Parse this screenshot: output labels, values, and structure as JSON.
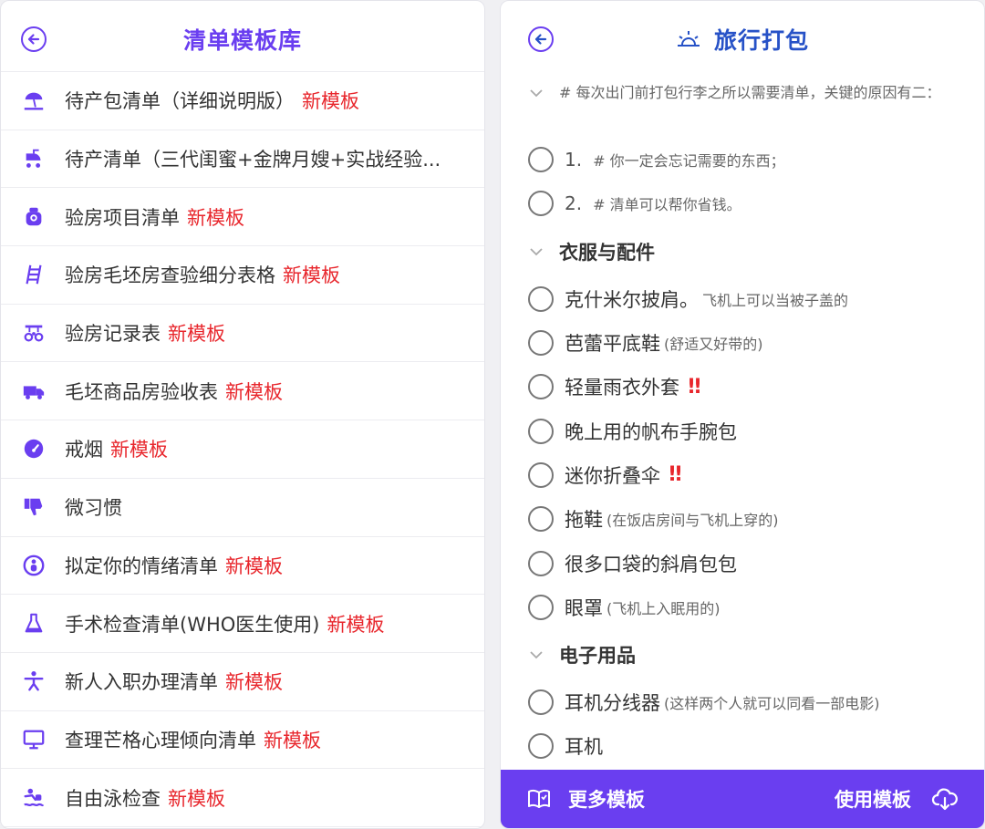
{
  "library": {
    "title": "清单模板库",
    "badge": "新模板",
    "templates": [
      {
        "label": "待产包清单（详细说明版）",
        "icon": "beach-umbrella-icon",
        "is_new": true
      },
      {
        "label": "待产清单（三代闺蜜+金牌月嫂+实战经验...",
        "icon": "baby-stroller-icon",
        "is_new": false
      },
      {
        "label": "验房项目清单",
        "icon": "house-inspection-icon",
        "is_new": true
      },
      {
        "label": "验房毛坯房查验细分表格",
        "icon": "ladder-icon",
        "is_new": true
      },
      {
        "label": "验房记录表",
        "icon": "tools-icon",
        "is_new": true
      },
      {
        "label": "毛坯商品房验收表",
        "icon": "truck-icon",
        "is_new": true
      },
      {
        "label": "戒烟",
        "icon": "speedometer-icon",
        "is_new": true
      },
      {
        "label": "微习惯",
        "icon": "thumbs-down-icon",
        "is_new": false
      },
      {
        "label": "拟定你的情绪清单",
        "icon": "person-circle-icon",
        "is_new": true
      },
      {
        "label": "手术检查清单(WHO医生使用)",
        "icon": "flask-icon",
        "is_new": true
      },
      {
        "label": "新人入职办理清单",
        "icon": "person-stretch-icon",
        "is_new": true
      },
      {
        "label": "查理芒格心理倾向清单",
        "icon": "monitor-icon",
        "is_new": true
      },
      {
        "label": "自由泳检查",
        "icon": "swimmer-icon",
        "is_new": true
      }
    ]
  },
  "detail": {
    "title": "旅行打包",
    "title_icon": "sunrise-icon",
    "intro": "# 每次出门前打包行李之所以需要清单，关键的原因有二：",
    "reasons": [
      {
        "num": "1.",
        "text": "# 你一定会忘记需要的东西；"
      },
      {
        "num": "2.",
        "text": "# 清单可以帮你省钱。"
      }
    ],
    "sections": [
      {
        "title": "衣服与配件",
        "items": [
          {
            "name": "克什米尔披肩。",
            "note": "飞机上可以当被子盖的",
            "alert": ""
          },
          {
            "name": "芭蕾平底鞋",
            "note": "(舒适又好带的)",
            "alert": ""
          },
          {
            "name": "轻量雨衣外套",
            "note": "",
            "alert": "!!"
          },
          {
            "name": "晚上用的帆布手腕包",
            "note": "",
            "alert": ""
          },
          {
            "name": "迷你折叠伞",
            "note": "",
            "alert": "!!"
          },
          {
            "name": "拖鞋",
            "note": "(在饭店房间与飞机上穿的)",
            "alert": ""
          },
          {
            "name": "很多口袋的斜肩包包",
            "note": "",
            "alert": ""
          },
          {
            "name": "眼罩",
            "note": "(飞机上入眠用的)",
            "alert": ""
          }
        ]
      },
      {
        "title": "电子用品",
        "items": [
          {
            "name": "耳机分线器",
            "note": "(这样两个人就可以同看一部电影)",
            "alert": ""
          },
          {
            "name": "耳机",
            "note": "",
            "alert": ""
          }
        ]
      }
    ],
    "bottom": {
      "more_label": "更多模板",
      "more_icon": "book-icon",
      "use_label": "使用模板",
      "use_icon": "cloud-download-icon"
    }
  },
  "colors": {
    "accent": "#6a3ef0",
    "title_blue": "#2752c7",
    "new_badge": "#e8262c"
  }
}
